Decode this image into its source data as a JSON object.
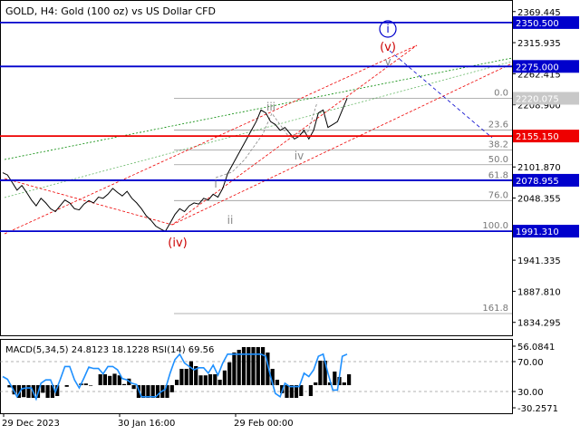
{
  "header": {
    "symbol_line": "GOLD, H4:  Gold (100 oz) vs US Dollar CFD"
  },
  "chart_data": {
    "type": "line",
    "title": "GOLD, H4:  Gold (100 oz) vs US Dollar CFD",
    "y_range": [
      1812,
      2380
    ],
    "price_ticks": [
      "2369.445",
      "2315.935",
      "2262.415",
      "2208.900",
      "2101.870",
      "2048.355",
      "1941.335",
      "1887.810",
      "1834.295"
    ],
    "x_labels": [
      "29 Dec 2023",
      "30 Jan 16:00",
      "29 Feb 00:00"
    ],
    "levels": [
      {
        "value": 2350.5,
        "label": "2350.500",
        "color": "#0000cc"
      },
      {
        "value": 2275.0,
        "label": "2275.000",
        "color": "#0000cc"
      },
      {
        "value": 2155.15,
        "label": "2155.150",
        "color": "#ee0000"
      },
      {
        "value": 2078.955,
        "label": "2078.955",
        "color": "#0000cc"
      },
      {
        "value": 1991.31,
        "label": "1991.310",
        "color": "#0000cc"
      }
    ],
    "current_price": {
      "value": 2220.075,
      "label": "2220.075"
    },
    "fibonacci": [
      {
        "ratio": "0.0",
        "value": 2220.075
      },
      {
        "ratio": "23.6",
        "value": 2165.5
      },
      {
        "ratio": "38.2",
        "value": 2131.3
      },
      {
        "ratio": "50.0",
        "value": 2105.7
      },
      {
        "ratio": "61.8",
        "value": 2078.3
      },
      {
        "ratio": "76.0",
        "value": 2044.0
      },
      {
        "ratio": "100.0",
        "value": 1991.31
      },
      {
        "ratio": "161.8",
        "value": 1849.5
      }
    ],
    "wave_labels": [
      {
        "text": "(iv)",
        "color": "#cc0000"
      },
      {
        "text": "i",
        "color": "#888888"
      },
      {
        "text": "ii",
        "color": "#888888"
      },
      {
        "text": "iii",
        "color": "#888888"
      },
      {
        "text": "iv",
        "color": "#888888"
      },
      {
        "text": "v",
        "color": "#888888"
      },
      {
        "text": "(v)",
        "color": "#cc0000"
      },
      {
        "text": "i",
        "color": "#0000cc"
      }
    ],
    "price_series": [
      2092,
      2088,
      2075,
      2062,
      2070,
      2058,
      2045,
      2035,
      2048,
      2040,
      2030,
      2025,
      2035,
      2045,
      2040,
      2030,
      2028,
      2038,
      2044,
      2040,
      2050,
      2048,
      2055,
      2065,
      2058,
      2052,
      2060,
      2048,
      2040,
      2030,
      2018,
      2010,
      2000,
      1995,
      1991,
      2005,
      2020,
      2030,
      2025,
      2035,
      2040,
      2038,
      2048,
      2045,
      2055,
      2050,
      2065,
      2090,
      2105,
      2120,
      2135,
      2150,
      2165,
      2180,
      2200,
      2195,
      2180,
      2175,
      2165,
      2170,
      2160,
      2150,
      2155,
      2165,
      2150,
      2165,
      2195,
      2200,
      2170,
      2175,
      2180,
      2200,
      2220
    ],
    "indicator": {
      "label": "MACD(5,34,5) 24.8123 18.1228 RSI(14) 69.56",
      "y_ticks": [
        "56.0841",
        "70.00",
        "30.00",
        "-30.2571"
      ]
    }
  }
}
